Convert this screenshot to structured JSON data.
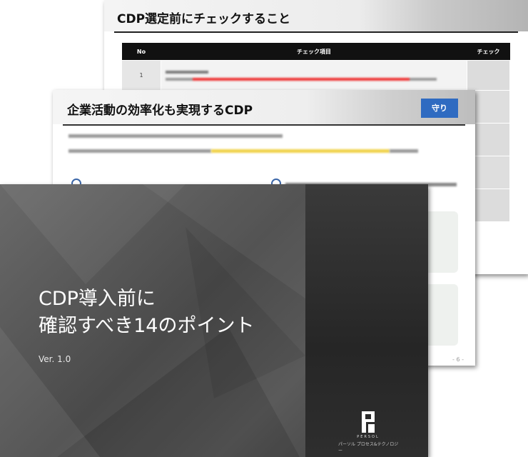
{
  "slide_back": {
    "title": "CDP選定前にチェックすること",
    "table": {
      "headers": [
        "No",
        "チェック項目",
        "チェック"
      ],
      "first_row_no": "1"
    }
  },
  "slide_middle": {
    "title": "企業活動の効率化も実現するCDP",
    "badge": "守り",
    "page_number": "- 6 -",
    "body_text_obscured": true
  },
  "slide_front": {
    "title_line1": "CDP導入前に",
    "title_line2": "確認すべき14のポイント",
    "version": "Ver. 1.0",
    "logo": {
      "brand": "PERSOL",
      "company": "パーソル プロセス&テクノロジー"
    }
  }
}
